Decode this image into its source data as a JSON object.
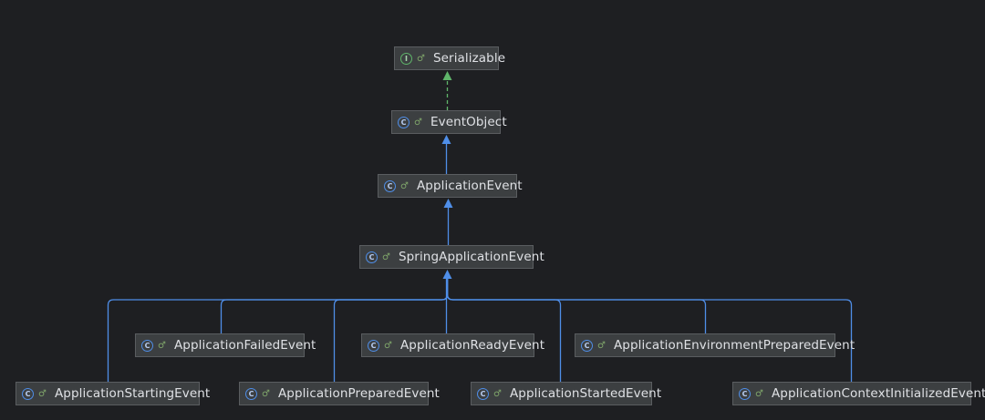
{
  "colors": {
    "background": "#1e1f22",
    "node_bg": "#3c3f41",
    "class_icon": "#4f8ee8",
    "interface_icon": "#5fb56a",
    "inheritance_line": "#4f8ee8",
    "implements_line": "#5fb56a"
  },
  "nodes": [
    {
      "id": "serializable",
      "label": "Serializable",
      "kind": "interface",
      "icon_letter": "I"
    },
    {
      "id": "event-object",
      "label": "EventObject",
      "kind": "class",
      "icon_letter": "C"
    },
    {
      "id": "application-event",
      "label": "ApplicationEvent",
      "kind": "class",
      "icon_letter": "C"
    },
    {
      "id": "spring-application-event",
      "label": "SpringApplicationEvent",
      "kind": "class",
      "icon_letter": "C"
    },
    {
      "id": "application-failed-event",
      "label": "ApplicationFailedEvent",
      "kind": "class",
      "icon_letter": "C"
    },
    {
      "id": "application-ready-event",
      "label": "ApplicationReadyEvent",
      "kind": "class",
      "icon_letter": "C"
    },
    {
      "id": "application-environment-prepared-event",
      "label": "ApplicationEnvironmentPreparedEvent",
      "kind": "class",
      "icon_letter": "C"
    },
    {
      "id": "application-starting-event",
      "label": "ApplicationStartingEvent",
      "kind": "class",
      "icon_letter": "C"
    },
    {
      "id": "application-prepared-event",
      "label": "ApplicationPreparedEvent",
      "kind": "class",
      "icon_letter": "C"
    },
    {
      "id": "application-started-event",
      "label": "ApplicationStartedEvent",
      "kind": "class",
      "icon_letter": "C"
    },
    {
      "id": "application-context-initialized-event",
      "label": "ApplicationContextInitializedEvent",
      "kind": "class",
      "icon_letter": "C"
    }
  ],
  "edges": [
    {
      "from": "event-object",
      "to": "serializable",
      "type": "implements"
    },
    {
      "from": "application-event",
      "to": "event-object",
      "type": "extends"
    },
    {
      "from": "spring-application-event",
      "to": "application-event",
      "type": "extends"
    },
    {
      "from": "application-starting-event",
      "to": "spring-application-event",
      "type": "extends"
    },
    {
      "from": "application-failed-event",
      "to": "spring-application-event",
      "type": "extends"
    },
    {
      "from": "application-prepared-event",
      "to": "spring-application-event",
      "type": "extends"
    },
    {
      "from": "application-ready-event",
      "to": "spring-application-event",
      "type": "extends"
    },
    {
      "from": "application-started-event",
      "to": "spring-application-event",
      "type": "extends"
    },
    {
      "from": "application-environment-prepared-event",
      "to": "spring-application-event",
      "type": "extends"
    },
    {
      "from": "application-context-initialized-event",
      "to": "spring-application-event",
      "type": "extends"
    }
  ]
}
